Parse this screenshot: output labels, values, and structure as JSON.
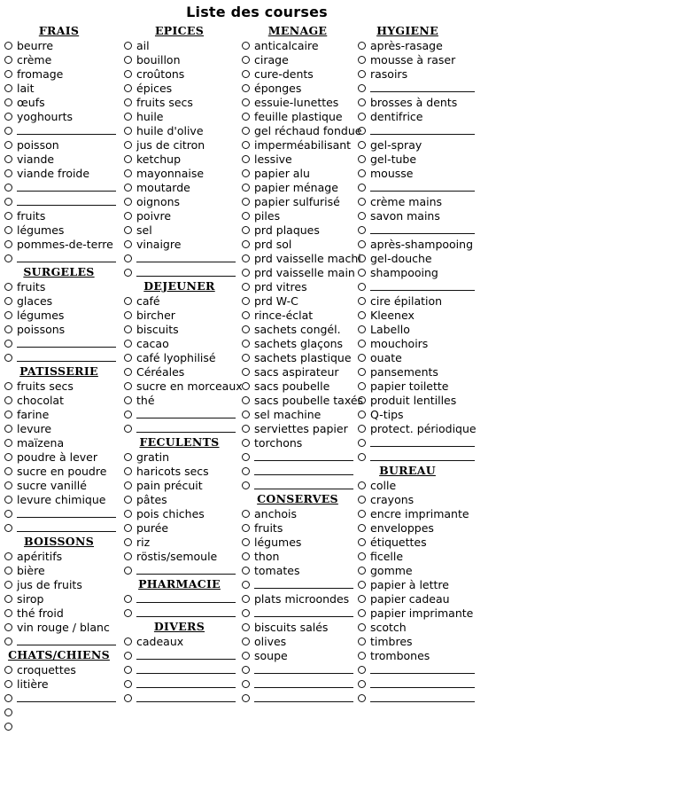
{
  "document": {
    "title": "Liste des courses"
  },
  "icons": {
    "bullet": "checkbox-circle-icon",
    "blank": "write-in-line"
  },
  "columns": [
    {
      "name": "column-1",
      "rows": [
        {
          "type": "heading",
          "text": "FRAIS"
        },
        {
          "type": "item",
          "text": "beurre"
        },
        {
          "type": "item",
          "text": "crème"
        },
        {
          "type": "item",
          "text": "fromage"
        },
        {
          "type": "item",
          "text": "lait"
        },
        {
          "type": "item",
          "text": "œufs"
        },
        {
          "type": "item",
          "text": "yoghourts"
        },
        {
          "type": "blank"
        },
        {
          "type": "item",
          "text": "poisson"
        },
        {
          "type": "item",
          "text": "viande"
        },
        {
          "type": "item",
          "text": "viande froide"
        },
        {
          "type": "blank"
        },
        {
          "type": "blank"
        },
        {
          "type": "item",
          "text": "fruits"
        },
        {
          "type": "item",
          "text": "légumes"
        },
        {
          "type": "item",
          "text": "pommes-de-terre"
        },
        {
          "type": "blank"
        },
        {
          "type": "heading",
          "text": "SURGELES"
        },
        {
          "type": "item",
          "text": "fruits"
        },
        {
          "type": "item",
          "text": "glaces"
        },
        {
          "type": "item",
          "text": "légumes"
        },
        {
          "type": "item",
          "text": "poissons"
        },
        {
          "type": "blank"
        },
        {
          "type": "blank"
        },
        {
          "type": "heading",
          "text": "PATISSERIE"
        },
        {
          "type": "item",
          "text": "fruits secs"
        },
        {
          "type": "item",
          "text": "chocolat"
        },
        {
          "type": "item",
          "text": "farine"
        },
        {
          "type": "item",
          "text": "levure"
        },
        {
          "type": "item",
          "text": "maïzena"
        },
        {
          "type": "item",
          "text": "poudre à lever"
        },
        {
          "type": "item",
          "text": "sucre en poudre"
        },
        {
          "type": "item",
          "text": "sucre vanillé"
        },
        {
          "type": "item",
          "text": "levure chimique"
        },
        {
          "type": "blank"
        },
        {
          "type": "blank"
        },
        {
          "type": "heading",
          "text": "BOISSONS"
        },
        {
          "type": "item",
          "text": "apéritifs"
        },
        {
          "type": "item",
          "text": "bière"
        },
        {
          "type": "item",
          "text": "jus de fruits"
        },
        {
          "type": "item",
          "text": "sirop"
        },
        {
          "type": "item",
          "text": "thé froid"
        },
        {
          "type": "item",
          "text": "vin rouge / blanc"
        },
        {
          "type": "blank"
        },
        {
          "type": "heading",
          "text": "CHATS/CHIENS"
        },
        {
          "type": "item",
          "text": "croquettes"
        },
        {
          "type": "item",
          "text": "litière"
        },
        {
          "type": "blank"
        },
        {
          "type": "empty"
        },
        {
          "type": "empty"
        }
      ]
    },
    {
      "name": "column-2",
      "rows": [
        {
          "type": "heading",
          "text": "EPICES"
        },
        {
          "type": "item",
          "text": "ail"
        },
        {
          "type": "item",
          "text": "bouillon"
        },
        {
          "type": "item",
          "text": "croûtons"
        },
        {
          "type": "item",
          "text": "épices"
        },
        {
          "type": "item",
          "text": "fruits secs"
        },
        {
          "type": "item",
          "text": "huile"
        },
        {
          "type": "item",
          "text": "huile d'olive"
        },
        {
          "type": "item",
          "text": "jus de citron"
        },
        {
          "type": "item",
          "text": "ketchup"
        },
        {
          "type": "item",
          "text": "mayonnaise"
        },
        {
          "type": "item",
          "text": "moutarde"
        },
        {
          "type": "item",
          "text": "oignons"
        },
        {
          "type": "item",
          "text": "poivre"
        },
        {
          "type": "item",
          "text": "sel"
        },
        {
          "type": "item",
          "text": "vinaigre"
        },
        {
          "type": "blank"
        },
        {
          "type": "blank"
        },
        {
          "type": "heading",
          "text": "DEJEUNER"
        },
        {
          "type": "item",
          "text": "café"
        },
        {
          "type": "item",
          "text": "bircher"
        },
        {
          "type": "item",
          "text": "biscuits"
        },
        {
          "type": "item",
          "text": "cacao"
        },
        {
          "type": "item",
          "text": "café lyophilisé"
        },
        {
          "type": "item",
          "text": "Céréales"
        },
        {
          "type": "item",
          "text": "sucre en morceaux"
        },
        {
          "type": "item",
          "text": "thé"
        },
        {
          "type": "blank"
        },
        {
          "type": "blank"
        },
        {
          "type": "heading",
          "text": "FECULENTS"
        },
        {
          "type": "item",
          "text": "gratin"
        },
        {
          "type": "item",
          "text": "haricots secs"
        },
        {
          "type": "item",
          "text": "pain précuit"
        },
        {
          "type": "item",
          "text": "pâtes"
        },
        {
          "type": "item",
          "text": "pois chiches"
        },
        {
          "type": "item",
          "text": "purée"
        },
        {
          "type": "item",
          "text": "riz"
        },
        {
          "type": "item",
          "text": "röstis/semoule"
        },
        {
          "type": "blank"
        },
        {
          "type": "heading",
          "text": "PHARMACIE"
        },
        {
          "type": "blank"
        },
        {
          "type": "blank"
        },
        {
          "type": "heading",
          "text": "DIVERS"
        },
        {
          "type": "item",
          "text": "cadeaux"
        },
        {
          "type": "blank"
        },
        {
          "type": "blank"
        },
        {
          "type": "blank"
        },
        {
          "type": "blank"
        }
      ]
    },
    {
      "name": "column-3",
      "rows": [
        {
          "type": "heading",
          "text": "MENAGE"
        },
        {
          "type": "item",
          "text": "anticalcaire"
        },
        {
          "type": "item",
          "text": "cirage"
        },
        {
          "type": "item",
          "text": "cure-dents"
        },
        {
          "type": "item",
          "text": "éponges"
        },
        {
          "type": "item",
          "text": "essuie-lunettes"
        },
        {
          "type": "item",
          "text": "feuille plastique"
        },
        {
          "type": "item",
          "text": "gel réchaud fondue"
        },
        {
          "type": "item",
          "text": "imperméabilisant"
        },
        {
          "type": "item",
          "text": "lessive"
        },
        {
          "type": "item",
          "text": "papier alu"
        },
        {
          "type": "item",
          "text": "papier ménage"
        },
        {
          "type": "item",
          "text": "papier sulfurisé"
        },
        {
          "type": "item",
          "text": "piles"
        },
        {
          "type": "item",
          "text": "prd plaques"
        },
        {
          "type": "item",
          "text": "prd sol"
        },
        {
          "type": "item",
          "text": "prd vaisselle machi"
        },
        {
          "type": "item",
          "text": "prd vaisselle main"
        },
        {
          "type": "item",
          "text": "prd vitres"
        },
        {
          "type": "item",
          "text": "prd W-C"
        },
        {
          "type": "item",
          "text": "rince-éclat"
        },
        {
          "type": "item",
          "text": "sachets congél."
        },
        {
          "type": "item",
          "text": "sachets glaçons"
        },
        {
          "type": "item",
          "text": "sachets plastique"
        },
        {
          "type": "item",
          "text": "sacs aspirateur"
        },
        {
          "type": "item",
          "text": "sacs poubelle"
        },
        {
          "type": "item",
          "text": "sacs poubelle taxés"
        },
        {
          "type": "item",
          "text": "sel machine"
        },
        {
          "type": "item",
          "text": "serviettes papier"
        },
        {
          "type": "item",
          "text": "torchons"
        },
        {
          "type": "blank"
        },
        {
          "type": "blank"
        },
        {
          "type": "blank"
        },
        {
          "type": "heading",
          "text": "CONSERVES"
        },
        {
          "type": "item",
          "text": "anchois"
        },
        {
          "type": "item",
          "text": "fruits"
        },
        {
          "type": "item",
          "text": "légumes"
        },
        {
          "type": "item",
          "text": "thon"
        },
        {
          "type": "item",
          "text": "tomates"
        },
        {
          "type": "blank"
        },
        {
          "type": "item",
          "text": "plats microondes"
        },
        {
          "type": "blank"
        },
        {
          "type": "item",
          "text": "biscuits salés"
        },
        {
          "type": "item",
          "text": "olives"
        },
        {
          "type": "item",
          "text": "soupe"
        },
        {
          "type": "blank"
        },
        {
          "type": "blank"
        },
        {
          "type": "blank"
        }
      ]
    },
    {
      "name": "column-4",
      "rows": [
        {
          "type": "heading",
          "text": "HYGIENE"
        },
        {
          "type": "item",
          "text": "après-rasage"
        },
        {
          "type": "item",
          "text": "mousse à raser"
        },
        {
          "type": "item",
          "text": "rasoirs"
        },
        {
          "type": "blank"
        },
        {
          "type": "item",
          "text": "brosses à dents"
        },
        {
          "type": "item",
          "text": "dentifrice"
        },
        {
          "type": "blank"
        },
        {
          "type": "item",
          "text": "gel-spray"
        },
        {
          "type": "item",
          "text": "gel-tube"
        },
        {
          "type": "item",
          "text": "mousse"
        },
        {
          "type": "blank"
        },
        {
          "type": "item",
          "text": "crème mains"
        },
        {
          "type": "item",
          "text": "savon mains"
        },
        {
          "type": "blank"
        },
        {
          "type": "item",
          "text": "après-shampooing"
        },
        {
          "type": "item",
          "text": "gel-douche"
        },
        {
          "type": "item",
          "text": "shampooing"
        },
        {
          "type": "blank"
        },
        {
          "type": "item",
          "text": "cire épilation"
        },
        {
          "type": "item",
          "text": "Kleenex"
        },
        {
          "type": "item",
          "text": "Labello"
        },
        {
          "type": "item",
          "text": "mouchoirs"
        },
        {
          "type": "item",
          "text": "ouate"
        },
        {
          "type": "item",
          "text": "pansements"
        },
        {
          "type": "item",
          "text": "papier toilette"
        },
        {
          "type": "item",
          "text": "produit lentilles"
        },
        {
          "type": "item",
          "text": "Q-tips"
        },
        {
          "type": "item",
          "text": "protect. périodique"
        },
        {
          "type": "blank"
        },
        {
          "type": "blank"
        },
        {
          "type": "heading",
          "text": "BUREAU"
        },
        {
          "type": "item",
          "text": "colle"
        },
        {
          "type": "item",
          "text": "crayons"
        },
        {
          "type": "item",
          "text": "encre imprimante"
        },
        {
          "type": "item",
          "text": "enveloppes"
        },
        {
          "type": "item",
          "text": "étiquettes"
        },
        {
          "type": "item",
          "text": "ficelle"
        },
        {
          "type": "item",
          "text": "gomme"
        },
        {
          "type": "item",
          "text": "papier à lettre"
        },
        {
          "type": "item",
          "text": "papier cadeau"
        },
        {
          "type": "item",
          "text": "papier imprimante"
        },
        {
          "type": "item",
          "text": "scotch"
        },
        {
          "type": "item",
          "text": "timbres"
        },
        {
          "type": "item",
          "text": "trombones"
        },
        {
          "type": "blank"
        },
        {
          "type": "blank"
        },
        {
          "type": "blank"
        }
      ]
    }
  ]
}
